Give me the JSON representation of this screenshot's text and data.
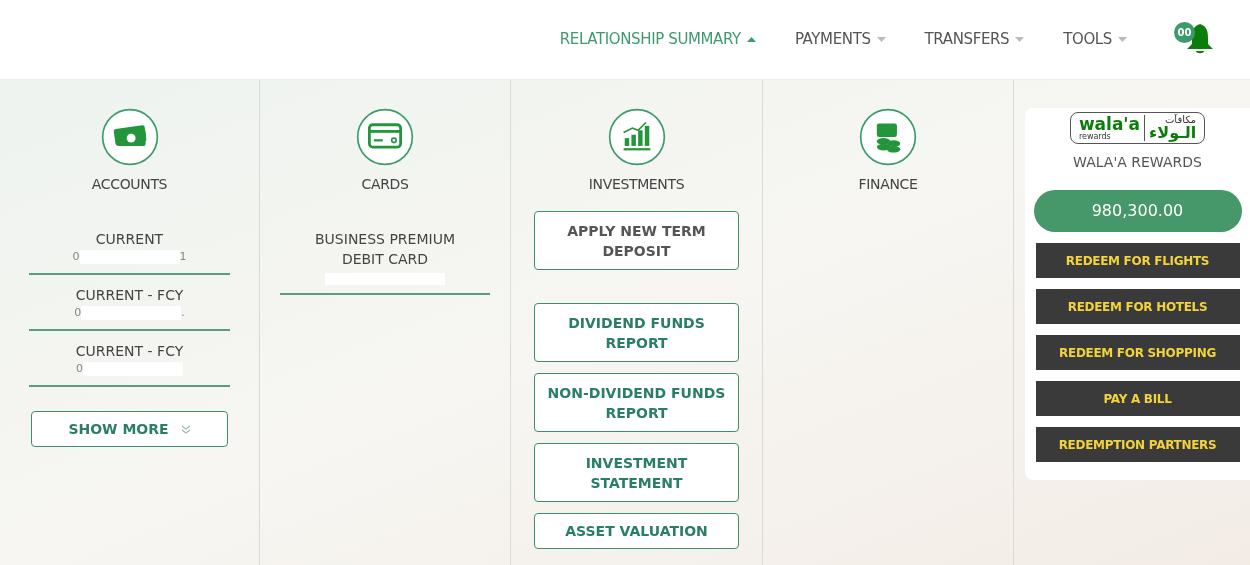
{
  "nav": {
    "items": [
      {
        "label": "RELATIONSHIP SUMMARY",
        "selected": true
      },
      {
        "label": "PAYMENTS",
        "selected": false
      },
      {
        "label": "TRANSFERS",
        "selected": false
      },
      {
        "label": "TOOLS",
        "selected": false
      }
    ],
    "notifications": {
      "count": "00"
    }
  },
  "columns": [
    {
      "kind": "accounts",
      "title": "ACCOUNTS",
      "items": [
        {
          "name": "CURRENT",
          "number_start": "0",
          "number_end": "1"
        },
        {
          "name": "CURRENT - FCY",
          "number_start": "0",
          "number_end": "."
        },
        {
          "name": "CURRENT - FCY",
          "number_start": "0"
        }
      ],
      "button": "SHOW MORE"
    },
    {
      "kind": "cards",
      "title": "CARDS",
      "items": [
        {
          "name": "BUSINESS PREMIUM DEBIT CARD"
        }
      ]
    },
    {
      "kind": "investments",
      "title": "INVESTMENTS",
      "buttons": [
        {
          "label": "APPLY NEW TERM DEPOSIT",
          "highlighted": false
        },
        {
          "label": "DIVIDEND FUNDS REPORT",
          "highlighted": true
        },
        {
          "label": "NON-DIVIDEND FUNDS REPORT",
          "highlighted": true
        },
        {
          "label": "INVESTMENT STATEMENT",
          "highlighted": true
        },
        {
          "label": "ASSET VALUATION",
          "highlighted": true
        }
      ]
    },
    {
      "kind": "finance",
      "title": "FINANCE"
    }
  ],
  "rewards": {
    "logo": {
      "latin": "wala'a",
      "sub": "rewards",
      "arabic": "الـولاء",
      "arabic_top": "مكافآت"
    },
    "title": "WALA'A REWARDS",
    "balance": "980,300.00",
    "actions": [
      "REDEEM FOR FLIGHTS",
      "REDEEM FOR HOTELS",
      "REDEEM FOR SHOPPING",
      "PAY A BILL",
      "REDEMPTION PARTNERS"
    ]
  }
}
